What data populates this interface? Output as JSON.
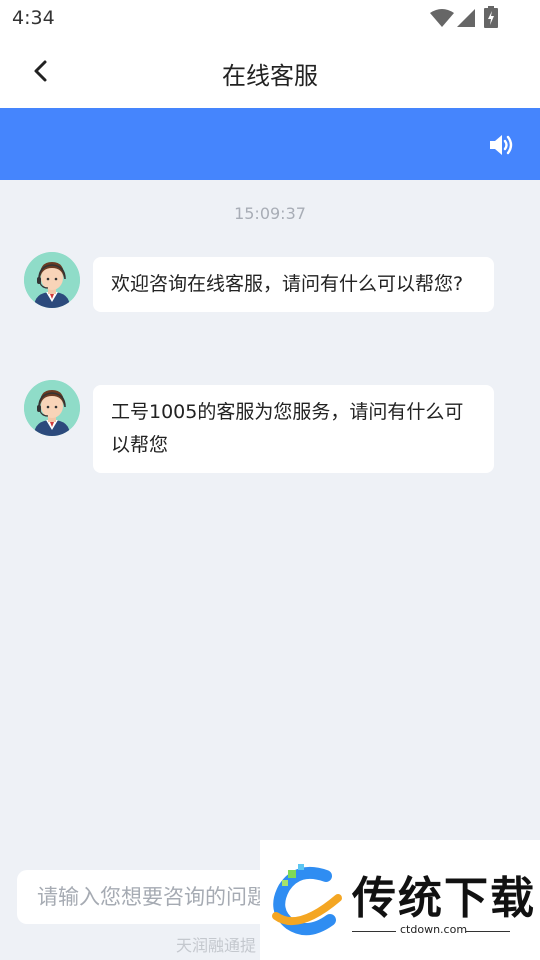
{
  "status_bar": {
    "time": "4:34"
  },
  "header": {
    "title": "在线客服"
  },
  "chat": {
    "timestamp": "15:09:37",
    "messages": [
      {
        "text": "欢迎咨询在线客服，请问有什么可以帮您?"
      },
      {
        "text": "工号1005的客服为您服务，请问有什么可以帮您"
      }
    ]
  },
  "input": {
    "placeholder": "请输入您想要咨询的问题"
  },
  "footer": {
    "text": "天润融通提"
  },
  "watermark": {
    "brand": "传统下载",
    "url": "ctdown.com"
  },
  "colors": {
    "banner": "#4585fd",
    "background": "#eef1f6"
  },
  "icons": {
    "back": "back-arrow-icon",
    "speaker": "speaker-icon"
  }
}
